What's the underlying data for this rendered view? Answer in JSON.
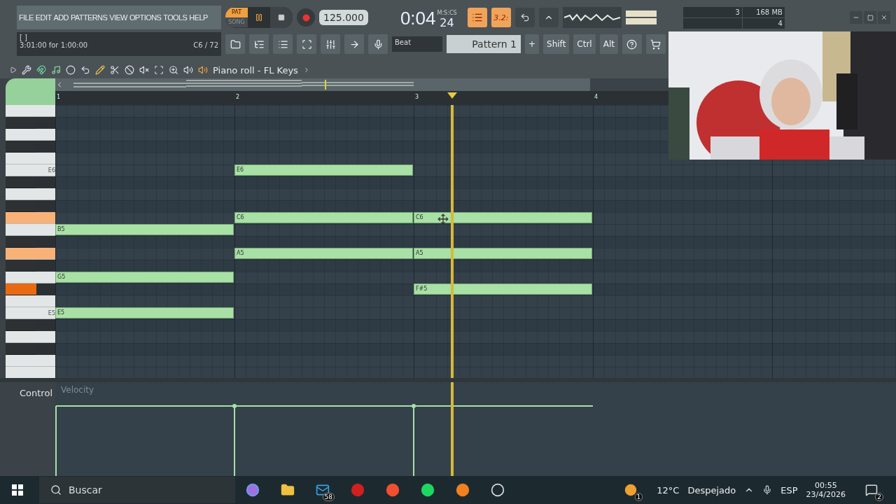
{
  "menu": [
    "FILE",
    "EDIT",
    "ADD",
    "PATTERNS",
    "VIEW",
    "OPTIONS",
    "TOOLS",
    "HELP"
  ],
  "transport": {
    "modes": [
      {
        "label": "PAT",
        "selected": true
      },
      {
        "label": "SONG",
        "selected": false
      }
    ],
    "playing": true,
    "tempo": "125.000",
    "time": "0:04",
    "time_small": "24",
    "time_format": "M:S:CS"
  },
  "snap_button": "3.2:",
  "cpu": {
    "value": "3",
    "memory": "168 MB",
    "polyphony": "4"
  },
  "hint": {
    "brackets": "[  ]",
    "text": "3:01:00 for 1:00:00",
    "note": "C6 / 72"
  },
  "snap": "Beat",
  "pattern": "Pattern 1",
  "pattern_add": "+",
  "modifiers": [
    "Shift",
    "Ctrl",
    "Alt"
  ],
  "piano_roll": {
    "title": "Piano roll - FL Keys",
    "ruler": [
      "1",
      "2",
      "3",
      "4"
    ],
    "keys": [
      {
        "black": false,
        "highlighted": false
      },
      {
        "black": true,
        "highlighted": false
      },
      {
        "black": false,
        "highlighted": false
      },
      {
        "black": true,
        "highlighted": false
      },
      {
        "black": false,
        "highlighted": false
      },
      {
        "black": false,
        "highlighted": false,
        "label": "E6"
      },
      {
        "black": true,
        "highlighted": false
      },
      {
        "black": false,
        "highlighted": false
      },
      {
        "black": true,
        "highlighted": false
      },
      {
        "black": false,
        "highlighted": true
      },
      {
        "black": false,
        "highlighted": false
      },
      {
        "black": true,
        "highlighted": false
      },
      {
        "black": false,
        "highlighted": true
      },
      {
        "black": true,
        "highlighted": false
      },
      {
        "black": false,
        "highlighted": false
      },
      {
        "black": true,
        "highlighted": true
      },
      {
        "black": false,
        "highlighted": false
      },
      {
        "black": false,
        "highlighted": false,
        "label": "E5"
      },
      {
        "black": true,
        "highlighted": false
      },
      {
        "black": false,
        "highlighted": false
      },
      {
        "black": true,
        "highlighted": false
      },
      {
        "black": false,
        "highlighted": false
      },
      {
        "black": false,
        "highlighted": false
      }
    ],
    "notes": [
      {
        "label": "E6"
      },
      {
        "label": "C6"
      },
      {
        "label": "C6"
      },
      {
        "label": "B5"
      },
      {
        "label": "A5"
      },
      {
        "label": "A5"
      },
      {
        "label": "G5"
      },
      {
        "label": "F#5"
      },
      {
        "label": "E5"
      }
    ]
  },
  "control": {
    "label": "Control",
    "parameter": "Velocity"
  },
  "taskbar": {
    "search": "Buscar",
    "mail_badge": "58",
    "weather_badge": "1",
    "temperature": "12°C",
    "weather": "Despejado",
    "language": "ESP",
    "time": "00:55",
    "date": "23/4/2026",
    "notifications": "2"
  }
}
